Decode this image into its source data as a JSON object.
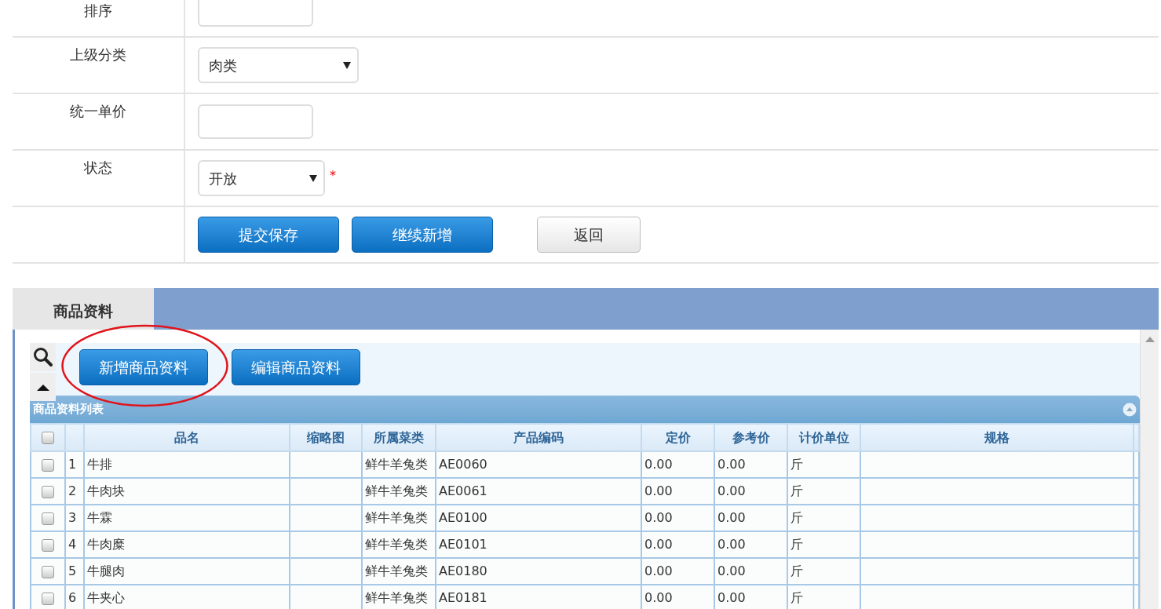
{
  "form": {
    "rows": [
      {
        "kind": "input",
        "label": "排序"
      },
      {
        "kind": "select",
        "label": "上级分类",
        "value": "肉类"
      },
      {
        "kind": "input",
        "label": "统一单价"
      },
      {
        "kind": "select",
        "label": "状态",
        "value": "开放",
        "required_mark": "*"
      },
      {
        "kind": "buttons",
        "buttons": [
          {
            "label": "提交保存",
            "kind": "action"
          },
          {
            "label": "继续新增",
            "kind": "action"
          },
          {
            "label": "返回",
            "kind": "back"
          }
        ]
      }
    ]
  },
  "panel": {
    "tab": "商品资料",
    "toolbar": [
      {
        "label": "新增商品资料",
        "circled": true
      },
      {
        "label": "编辑商品资料",
        "circled": false
      }
    ],
    "grid": {
      "title": "商品资料列表",
      "all_checked": false,
      "columns": [
        "品名",
        "缩略图",
        "所属菜类",
        "产品编码",
        "定价",
        "参考价",
        "计价单位",
        "规格"
      ],
      "rows": [
        {
          "checked": false,
          "seq": "1",
          "name": "牛排",
          "category": "鲜牛羊兔类",
          "code": "AE0060",
          "price": "0.00",
          "ref_price": "0.00",
          "unit": "斤"
        },
        {
          "checked": false,
          "seq": "2",
          "name": "牛肉块",
          "category": "鲜牛羊兔类",
          "code": "AE0061",
          "price": "0.00",
          "ref_price": "0.00",
          "unit": "斤"
        },
        {
          "checked": false,
          "seq": "3",
          "name": "牛霖",
          "category": "鲜牛羊兔类",
          "code": "AE0100",
          "price": "0.00",
          "ref_price": "0.00",
          "unit": "斤"
        },
        {
          "checked": false,
          "seq": "4",
          "name": "牛肉糜",
          "category": "鲜牛羊兔类",
          "code": "AE0101",
          "price": "0.00",
          "ref_price": "0.00",
          "unit": "斤"
        },
        {
          "checked": false,
          "seq": "5",
          "name": "牛腿肉",
          "category": "鲜牛羊兔类",
          "code": "AE0180",
          "price": "0.00",
          "ref_price": "0.00",
          "unit": "斤"
        },
        {
          "checked": false,
          "seq": "6",
          "name": "牛夹心",
          "category": "鲜牛羊兔类",
          "code": "AE0181",
          "price": "0.00",
          "ref_price": "0.00",
          "unit": "斤"
        }
      ]
    }
  }
}
